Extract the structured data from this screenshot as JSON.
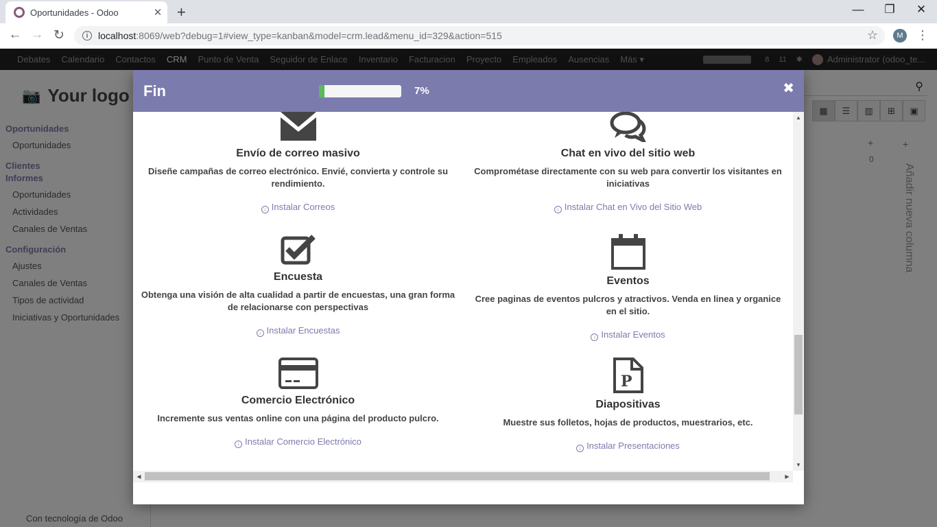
{
  "browser": {
    "tab_title": "Oportunidades - Odoo",
    "new_tab": "+",
    "url_host": "localhost",
    "url_rest": ":8069/web?debug=1#view_type=kanban&model=crm.lead&menu_id=329&action=515",
    "profile_initial": "M"
  },
  "odoo_nav": {
    "items": [
      "Debates",
      "Calendario",
      "Contactos",
      "CRM",
      "Punto de Venta",
      "Seguidor de Enlace",
      "Inventario",
      "Facturacion",
      "Proyecto",
      "Empleados",
      "Ausencias",
      "Más ▾"
    ],
    "badge_msgs": "8",
    "badge_chat": "11",
    "user": "Administrator (odoo_te..."
  },
  "sidebar": {
    "logo": "Your logo",
    "sections": [
      {
        "title": "Oportunidades",
        "items": [
          "Oportunidades"
        ]
      },
      {
        "title": "Clientes",
        "items": []
      },
      {
        "title": "Informes",
        "items": [
          "Oportunidades",
          "Actividades",
          "Canales de Ventas"
        ]
      },
      {
        "title": "Configuración",
        "items": [
          "Ajustes",
          "Canales de Ventas",
          "Tipos de actividad",
          "Iniciativas y Oportunidades"
        ]
      }
    ],
    "powered": "Con tecnología de Odoo"
  },
  "kanban": {
    "add_column": "Añadir nueva columna",
    "zero": "0"
  },
  "modal": {
    "title": "Fin",
    "progress_percent": 7,
    "progress_label": "7%",
    "close": "✖",
    "apps": [
      {
        "icon": "envelope-icon",
        "name": "Envío de correo masivo",
        "desc": "Diseñe campañas de correo electrónico. Envié, convierta y controle su rendimiento.",
        "install": "Instalar Correos"
      },
      {
        "icon": "chat-bubbles-icon",
        "name": "Chat en vivo del sitio web",
        "desc": "Comprométase directamente con su web para convertir los visitantes en iniciativas",
        "install": "Instalar Chat en Vivo del Sitio Web"
      },
      {
        "icon": "checkbox-icon",
        "name": "Encuesta",
        "desc": "Obtenga una visión de alta cualidad a partir de encuestas, una gran forma de relacionarse con perspectivas",
        "install": "Instalar Encuestas"
      },
      {
        "icon": "calendar-icon",
        "name": "Eventos",
        "desc": "Cree paginas de eventos pulcros y atractivos. Venda en linea y organice en el sitio.",
        "install": "Instalar Eventos"
      },
      {
        "icon": "credit-card-icon",
        "name": "Comercio Electrónico",
        "desc": "Incremente sus ventas online con una página del producto pulcro.",
        "install": "Instalar Comercio Electrónico"
      },
      {
        "icon": "slides-file-icon",
        "name": "Diapositivas",
        "desc": "Muestre sus folletos, hojas de productos, muestrarios, etc.",
        "install": "Instalar Presentaciones"
      }
    ]
  }
}
